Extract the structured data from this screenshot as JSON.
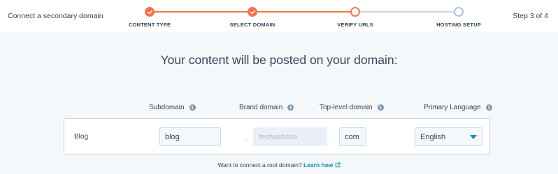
{
  "header": {
    "title": "Connect a secondary domain",
    "step_count": "Step 3 of 4"
  },
  "stepper": {
    "steps": [
      {
        "label": "CONTENT TYPE",
        "state": "done"
      },
      {
        "label": "SELECT DOMAIN",
        "state": "done"
      },
      {
        "label": "VERIFY URLS",
        "state": "current"
      },
      {
        "label": "HOSTING SETUP",
        "state": "todo"
      }
    ]
  },
  "main": {
    "headline": "Your content will be posted on your domain:",
    "columns": {
      "subdomain": "Subdomain",
      "brand_domain": "Brand domain",
      "top_level_domain": "Top-level domain",
      "primary_language": "Primary Language"
    },
    "row": {
      "label": "Blog",
      "subdomain_value": "blog",
      "brand_domain_placeholder": "testwebsite",
      "separator": ".",
      "tld_value": "com",
      "language_value": "English"
    },
    "footer": {
      "text": "Want to connect a root domain?",
      "link": "Learn how"
    }
  },
  "colors": {
    "accent": "#f2754e",
    "link": "#0091ae",
    "text": "#33475b"
  }
}
